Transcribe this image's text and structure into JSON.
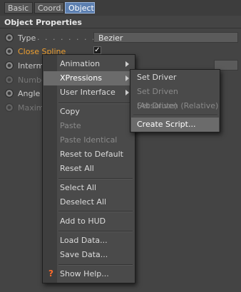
{
  "tabs": [
    "Basic",
    "Coord.",
    "Object"
  ],
  "section_title": "Object Properties",
  "properties": {
    "type": {
      "label": "Type",
      "dots": ". . . . . . . . . . . .",
      "value": "Bezier"
    },
    "close_spline": {
      "label": "Close Spline",
      "checked_mark": "✓"
    },
    "intermediate": {
      "label": "Interm"
    },
    "number": {
      "label": "Numbe"
    },
    "angle": {
      "label": "Angle"
    },
    "maximum": {
      "label": "Maxim"
    }
  },
  "context_menu": {
    "animation": "Animation",
    "xpressions": "XPressions",
    "user_interface": "User Interface",
    "copy": "Copy",
    "paste": "Paste",
    "paste_identical": "Paste Identical",
    "reset_to_default": "Reset to Default",
    "reset_all": "Reset All",
    "select_all": "Select All",
    "deselect_all": "Deselect All",
    "add_to_hud": "Add to HUD",
    "load_data": "Load Data...",
    "save_data": "Save Data...",
    "show_help": "Show Help...",
    "help_icon_glyph": "?"
  },
  "submenu": {
    "set_driver": "Set Driver",
    "set_driven_absolute": "Set Driven (Absolute)",
    "set_driven_relative": "Set Driven (Relative)",
    "create_script": "Create Script..."
  }
}
